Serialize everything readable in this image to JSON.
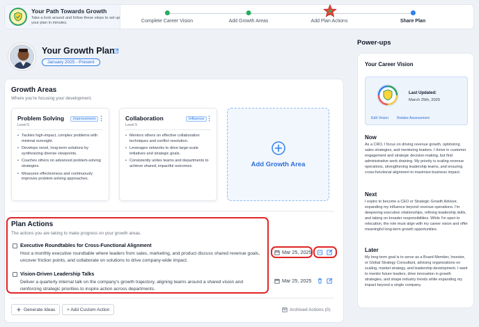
{
  "header": {
    "path_title": "Your Path Towards Growth",
    "path_subtitle": "Take a look around and follow these steps to set up your plan in minutes.",
    "steps": [
      {
        "label": "Complete Career Vision",
        "status": "complete"
      },
      {
        "label": "Add Growth Areas",
        "status": "complete"
      },
      {
        "label": "Add Plan Actions",
        "status": "complete"
      },
      {
        "label": "Share Plan",
        "status": "current"
      }
    ]
  },
  "page": {
    "title": "Your Growth Plan",
    "date_range": "January 2025 - Present"
  },
  "growth_areas": {
    "title": "Growth Areas",
    "subtitle": "Where you're focusing your development.",
    "cards": [
      {
        "name": "Problem Solving",
        "level": "Level 5",
        "badge": "Improvement",
        "bullets": [
          "Tackles high-impact, complex problems with minimal oversight.",
          "Develops novel, long-term solutions by synthesizing diverse viewpoints.",
          "Coaches others on advanced problem-solving strategies.",
          "Measures effectiveness and continuously improves problem-solving approaches."
        ]
      },
      {
        "name": "Collaboration",
        "level": "Level 5",
        "badge": "Influence",
        "bullets": [
          "Mentors others on effective collaboration techniques and conflict resolution.",
          "Leverages networks to drive large-scale initiatives and strategic goals.",
          "Consistently unites teams and departments to achieve shared, impactful outcomes."
        ]
      }
    ],
    "add_label": "Add Growth Area"
  },
  "plan_actions": {
    "title": "Plan Actions",
    "subtitle": "The actions you are taking to make progress on your growth areas.",
    "items": [
      {
        "title": "Executive Roundtables for Cross-Functional Alignment",
        "description": "Host a monthly executive roundtable where leaders from sales, marketing, and product discuss shared revenue goals, uncover friction points, and collaborate on solutions to drive company-wide impact.",
        "date": "Mar 25, 2025"
      },
      {
        "title": "Vision-Driven Leadership Talks",
        "description": "Deliver a quarterly internal talk on the company's growth trajectory, aligning teams around a shared vision and reinforcing strategic priorities to inspire action across departments.",
        "date": "Mar 25, 2025"
      }
    ],
    "generate_label": "Generate Ideas",
    "custom_label": "+ Add Custom Action",
    "archived_label": "Archived Actions (0)"
  },
  "sidebar": {
    "title": "Power-ups",
    "card_title": "Your Career Vision",
    "last_updated_label": "Last Updated:",
    "last_updated_date": "March 25th, 2025",
    "edit_vision": "Edit Vision",
    "retake": "Retake Assessment",
    "sections": [
      {
        "heading": "Now",
        "text": "As a CRO, I focus on driving revenue growth, optimizing sales strategies, and mentoring leaders. I thrive in customer engagement and strategic decision-making, but find administrative work draining. My priority is scaling revenue operations, strengthening leadership teams, and ensuring cross-functional alignment to maximize business impact."
      },
      {
        "heading": "Next",
        "text": "I expire to become a CEO or Strategic Growth Advisor, expanding my influence beyond revenue operations. I'm deepening executive relationships, refining leadership skills, and taking on broader responsibilities. While I'm open to relocation, the role must align with my career vision and offer meaningful long-term growth opportunities."
      },
      {
        "heading": "Later",
        "text": "My long-term goal is to serve as a Board Member, Investor, or Global Strategy Consultant, advising organizations on scaling, market strategy, and leadership development. I want to mentor future leaders, drive innovation in growth strategies, and shape industry trends while expanding my impact beyond a single company."
      }
    ]
  },
  "colors": {
    "accent": "#2f80ed",
    "complete": "#27ae60",
    "highlight": "#e02424"
  }
}
